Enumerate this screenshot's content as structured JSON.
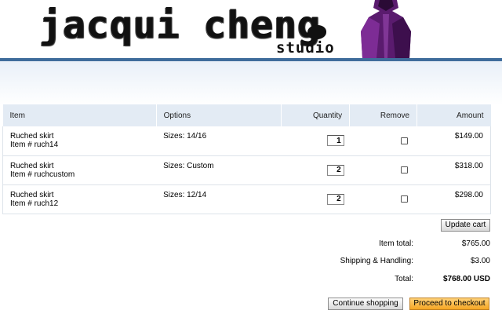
{
  "header": {
    "logo_text": "jacqui cheng",
    "logo_subtext": "studio"
  },
  "cart": {
    "columns": {
      "item": "Item",
      "options": "Options",
      "quantity": "Quantity",
      "remove": "Remove",
      "amount": "Amount"
    },
    "rows": [
      {
        "name": "Ruched skirt",
        "item_number": "Item # ruch14",
        "options": "Sizes: 14/16",
        "quantity": "1",
        "remove": false,
        "amount": "$149.00"
      },
      {
        "name": "Ruched skirt",
        "item_number": "Item # ruchcustom",
        "options": "Sizes: Custom",
        "quantity": "2",
        "remove": false,
        "amount": "$318.00"
      },
      {
        "name": "Ruched skirt",
        "item_number": "Item # ruch12",
        "options": "Sizes: 12/14",
        "quantity": "2",
        "remove": false,
        "amount": "$298.00"
      }
    ],
    "update_label": "Update cart"
  },
  "totals": {
    "item_total_label": "Item total:",
    "item_total_value": "$765.00",
    "shipping_label": "Shipping & Handling:",
    "shipping_value": "$3.00",
    "total_label": "Total:",
    "total_value": "$768.00 USD"
  },
  "actions": {
    "continue_label": "Continue shopping",
    "checkout_label": "Proceed to checkout"
  },
  "colors": {
    "header_rule": "#3f6c9b",
    "table_header_bg": "#e3ebf4",
    "checkout_button": "#f5a623"
  }
}
